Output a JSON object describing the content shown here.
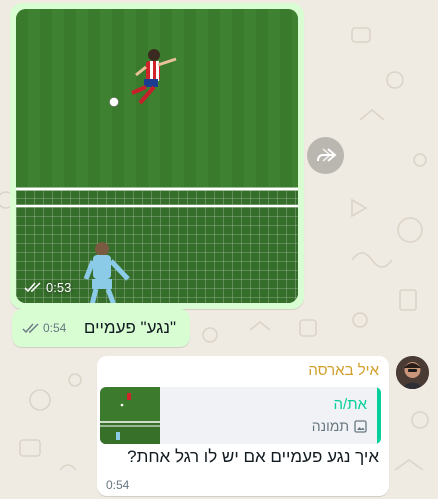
{
  "colors": {
    "background": "#efeae2",
    "outgoing_bubble": "#d9fdd3",
    "incoming_bubble": "#ffffff",
    "sender_name": "#d1a02c",
    "quote_accent": "#06cf9c",
    "meta_text": "#667781"
  },
  "video_message": {
    "duration": "0:53",
    "status_icon": "double-check-icon",
    "forward_icon": "forward-icon"
  },
  "text_message": {
    "text": "\"נגע\" פעמיים",
    "time": "0:54",
    "status_icon": "double-check-icon"
  },
  "reply_message": {
    "sender": "איל בארסה",
    "quoted": {
      "author": "את/ה",
      "type_label": "תמונה",
      "type_icon": "image-icon"
    },
    "text": "איך נגע פעמיים אם יש לו רגל אחת?",
    "time": "0:54"
  }
}
